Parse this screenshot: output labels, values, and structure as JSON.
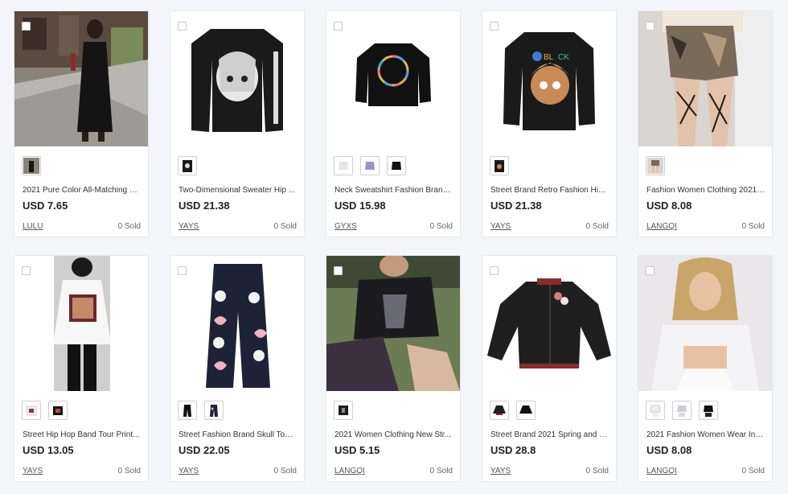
{
  "products": [
    {
      "title": "2021 Pure Color All-Matching H...",
      "price": "USD 7.65",
      "brand": "LULU",
      "sold": "0 Sold"
    },
    {
      "title": "Two-Dimensional Sweater Hip ...",
      "price": "USD 21.38",
      "brand": "YAYS",
      "sold": "0 Sold"
    },
    {
      "title": "Neck Sweatshirt Fashion Brand ...",
      "price": "USD 15.98",
      "brand": "GYXS",
      "sold": "0 Sold"
    },
    {
      "title": "Street Brand Retro Fashion Hip ...",
      "price": "USD 21.38",
      "brand": "YAYS",
      "sold": "0 Sold"
    },
    {
      "title": "Fashion Women Clothing 2021 ...",
      "price": "USD 8.08",
      "brand": "LANGQI",
      "sold": "0 Sold"
    },
    {
      "title": "Street Hip Hop Band Tour Print...",
      "price": "USD 13.05",
      "brand": "YAYS",
      "sold": "0 Sold"
    },
    {
      "title": "Street Fashion Brand Skull Towe...",
      "price": "USD 22.05",
      "brand": "YAYS",
      "sold": "0 Sold"
    },
    {
      "title": "2021 Women Clothing New Str...",
      "price": "USD 5.15",
      "brand": "LANGQI",
      "sold": "0 Sold"
    },
    {
      "title": "Street Brand 2021 Spring and S...",
      "price": "USD 28.8",
      "brand": "YAYS",
      "sold": "0 Sold"
    },
    {
      "title": "2021 Fashion Women Wear Inte...",
      "price": "USD 8.08",
      "brand": "LANGQI",
      "sold": "0 Sold"
    }
  ]
}
